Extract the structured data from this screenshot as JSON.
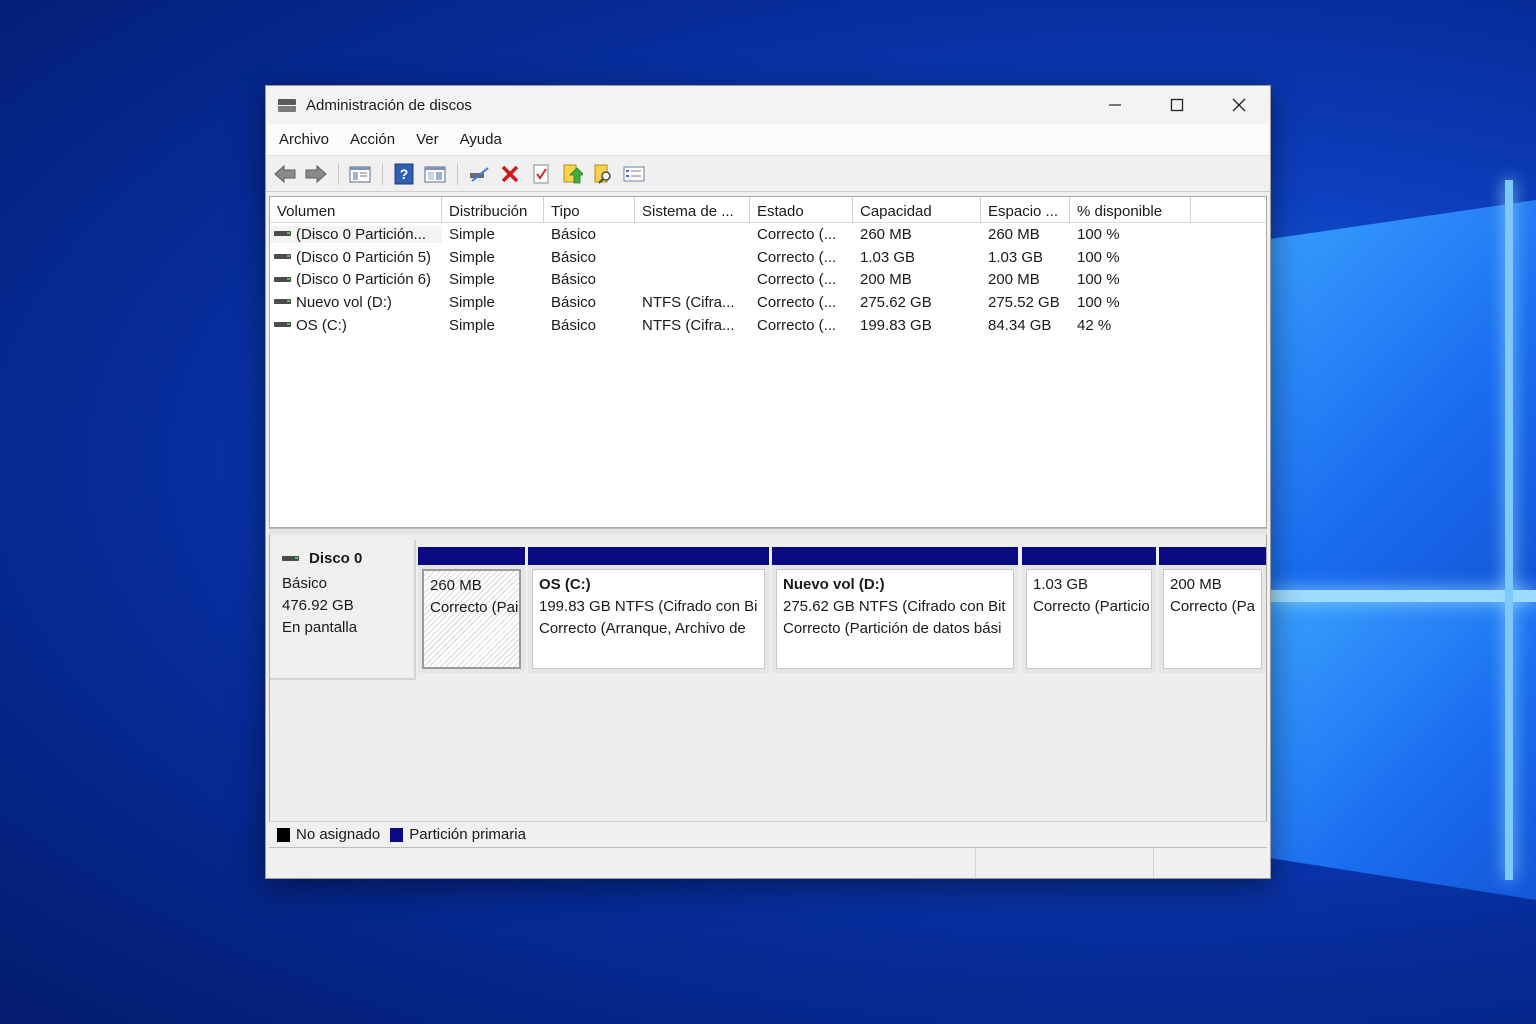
{
  "window": {
    "title": "Administración de discos",
    "controls": {
      "minimize": "—",
      "maximize": "☐",
      "close": "✕"
    }
  },
  "menu": [
    "Archivo",
    "Acción",
    "Ver",
    "Ayuda"
  ],
  "toolbar": [
    "back-arrow-icon",
    "forward-arrow-icon",
    "console-tree-icon",
    "help-icon",
    "view-icon",
    "connect-disk-icon",
    "delete-icon",
    "properties-icon",
    "rescan-icon",
    "search-icon",
    "settings-icon"
  ],
  "list": {
    "columns": [
      "Volumen",
      "Distribución",
      "Tipo",
      "Sistema de ...",
      "Estado",
      "Capacidad",
      "Espacio ...",
      "% disponible"
    ],
    "rows": [
      [
        "(Disco 0 Partición...",
        "Simple",
        "Básico",
        "",
        "Correcto (...",
        "260 MB",
        "260 MB",
        "100 %"
      ],
      [
        "(Disco 0 Partición 5)",
        "Simple",
        "Básico",
        "",
        "Correcto (...",
        "1.03 GB",
        "1.03 GB",
        "100 %"
      ],
      [
        "(Disco 0 Partición 6)",
        "Simple",
        "Básico",
        "",
        "Correcto (...",
        "200 MB",
        "200 MB",
        "100 %"
      ],
      [
        "Nuevo vol (D:)",
        "Simple",
        "Básico",
        "NTFS (Cifra...",
        "Correcto (...",
        "275.62 GB",
        "275.52 GB",
        "100 %"
      ],
      [
        "OS (C:)",
        "Simple",
        "Básico",
        "NTFS (Cifra...",
        "Correcto (...",
        "199.83 GB",
        "84.34 GB",
        "42 %"
      ]
    ]
  },
  "disk": {
    "name": "Disco 0",
    "type": "Básico",
    "size": "476.92 GB",
    "status": "En pantalla"
  },
  "partitions": [
    {
      "name": "",
      "line1": "260 MB",
      "line2": "Correcto (Pai",
      "hatched": true
    },
    {
      "name": "OS  (C:)",
      "line1": "199.83 GB NTFS (Cifrado con Bi",
      "line2": "Correcto (Arranque, Archivo de"
    },
    {
      "name": "Nuevo vol  (D:)",
      "line1": "275.62 GB NTFS (Cifrado con Bit",
      "line2": "Correcto (Partición de datos bási"
    },
    {
      "name": "",
      "line1": "1.03 GB",
      "line2": "Correcto (Particio"
    },
    {
      "name": "",
      "line1": "200 MB",
      "line2": "Correcto (Pa"
    }
  ],
  "legend": [
    {
      "label": "No asignado",
      "color": "#000000"
    },
    {
      "label": "Partición primaria",
      "color": "#0a0a80"
    }
  ]
}
